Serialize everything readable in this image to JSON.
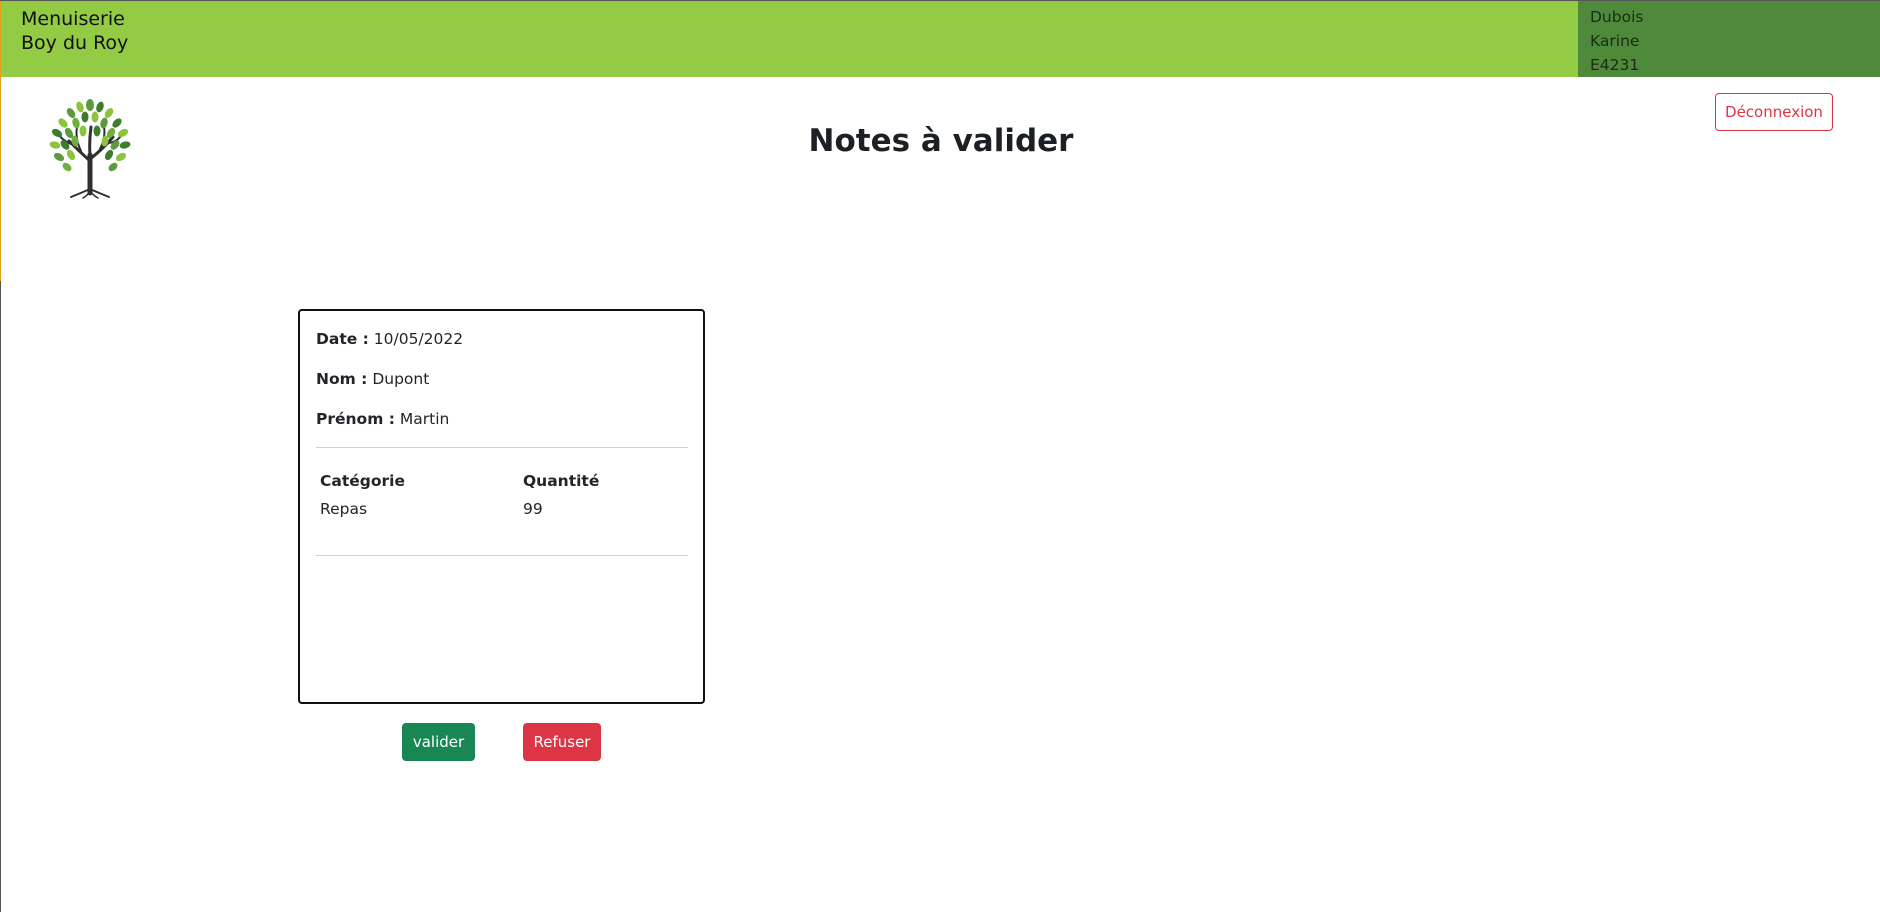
{
  "header": {
    "brand_line1": "Menuiserie",
    "brand_line2": "Boy du Roy",
    "user": {
      "last_name": "Dubois",
      "first_name": "Karine",
      "id": "E4231"
    },
    "colors": {
      "bar": "#93cb45",
      "user_panel": "#4e8a3a"
    }
  },
  "logo": {
    "icon": "tree-icon"
  },
  "logout_label": "Déconnexion",
  "page_title": "Notes à valider",
  "note": {
    "date_label": "Date :",
    "date_value": "10/05/2022",
    "nom_label": "Nom :",
    "nom_value": "Dupont",
    "prenom_label": "Prénom :",
    "prenom_value": "Martin",
    "table": {
      "headers": [
        "Catégorie",
        "Quantité"
      ],
      "rows": [
        [
          "Repas",
          "99"
        ]
      ]
    }
  },
  "actions": {
    "validate_label": "valider",
    "refuse_label": "Refuser",
    "colors": {
      "validate": "#198754",
      "refuse": "#dc3545"
    }
  }
}
